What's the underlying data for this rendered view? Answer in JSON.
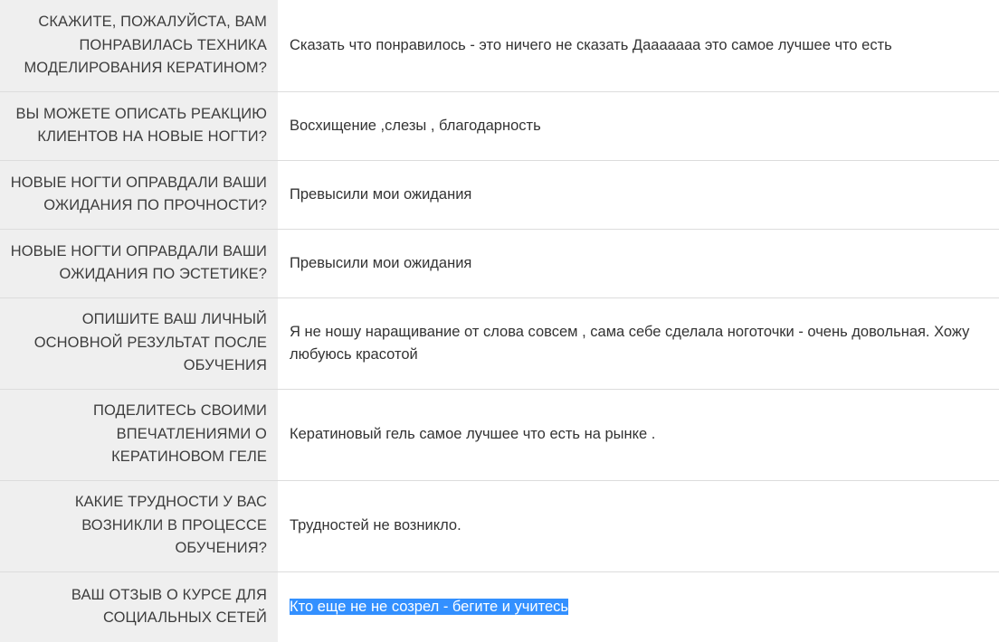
{
  "rows": [
    {
      "question": "Скажите, пожалуйста, вам понравилась техника моделирования кератином?",
      "answer": "Сказать что понравилось - это ничего не сказать Дааааааа это самое лучшее что есть"
    },
    {
      "question": "Вы можете описать реакцию клиентов на новые ногти?",
      "answer": "Восхищение ,слезы , благодарность"
    },
    {
      "question": "Новые ногти оправдали ваши ожидания по прочности?",
      "answer": "Превысили мои ожидания"
    },
    {
      "question": "Новые ногти оправдали ваши ожидания по эстетике?",
      "answer": "Превысили мои ожидания"
    },
    {
      "question": "Опишите ваш личный основной результат после обучения",
      "answer": "Я не ношу наращивание от слова совсем , сама себе сделала ноготочки - очень довольная. Хожу любуюсь красотой"
    },
    {
      "question": "Поделитесь своими впечатлениями о кератиновом геле",
      "answer": "Кератиновый гель самое лучшее что есть на рынке ."
    },
    {
      "question": "Какие трудности у вас возникли в процессе обучения?",
      "answer": "Трудностей не возникло."
    },
    {
      "question": "Ваш отзыв о курсе для социальных сетей",
      "answer": "Кто еще не не созрел - бегите и учитесь"
    }
  ],
  "colors": {
    "question_bg": "#efefef",
    "answer_bg": "#ffffff",
    "divider": "#dcdcdc",
    "selection_highlight": "#3390ff"
  }
}
